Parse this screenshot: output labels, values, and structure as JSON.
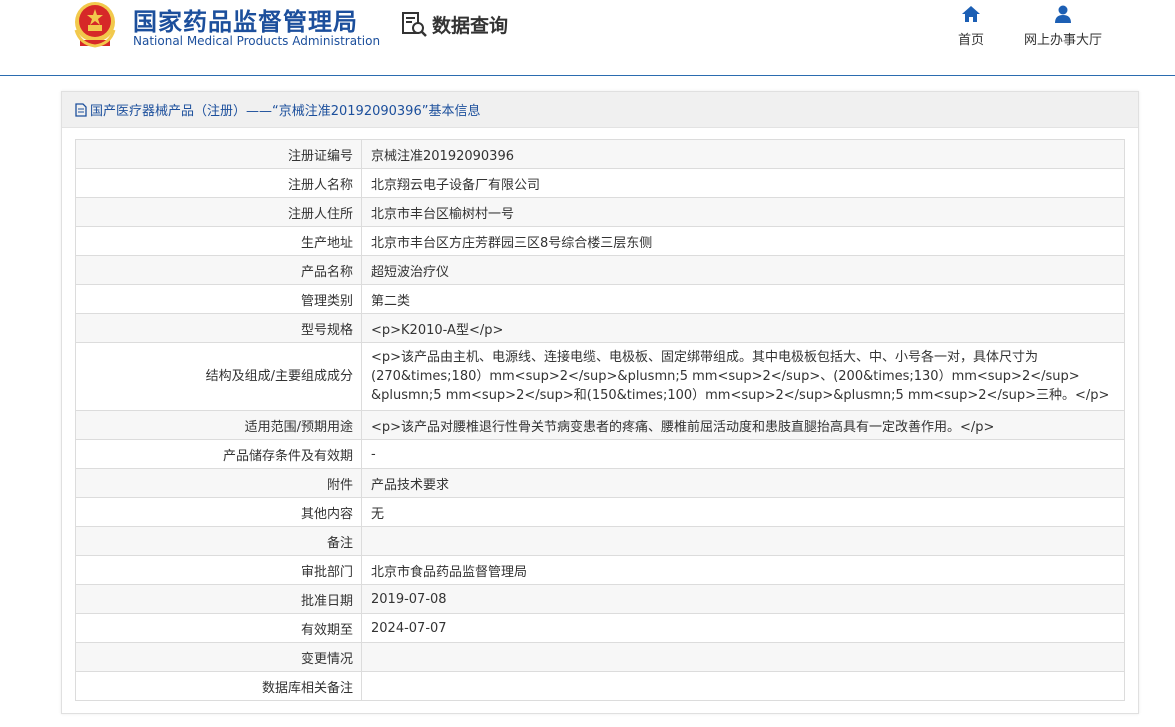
{
  "header": {
    "logo_cn": "国家药品监督管理局",
    "logo_en": "National Medical Products Administration",
    "data_query": "数据查询",
    "nav": [
      {
        "label": "首页",
        "icon": "home-icon"
      },
      {
        "label": "网上办事大厅",
        "icon": "user-icon"
      }
    ]
  },
  "panel": {
    "title": "国产医疗器械产品（注册）——“京械注准20192090396”基本信息"
  },
  "rows": [
    {
      "label": "注册证编号",
      "value": "京械注准20192090396"
    },
    {
      "label": "注册人名称",
      "value": "北京翔云电子设备厂有限公司"
    },
    {
      "label": "注册人住所",
      "value": "北京市丰台区榆树村一号"
    },
    {
      "label": "生产地址",
      "value": "北京市丰台区方庄芳群园三区8号综合楼三层东侧"
    },
    {
      "label": "产品名称",
      "value": "超短波治疗仪"
    },
    {
      "label": "管理类别",
      "value": "第二类"
    },
    {
      "label": "型号规格",
      "value": "<p>K2010-A型</p>"
    },
    {
      "label": "结构及组成/主要组成成分",
      "value": "<p>该产品由主机、电源线、连接电缆、电极板、固定绑带组成。其中电极板包括大、中、小号各一对，具体尺寸为(270&times;180）mm<sup>2</sup>&plusmn;5 mm<sup>2</sup>、(200&times;130）mm<sup>2</sup> &plusmn;5 mm<sup>2</sup>和(150&times;100）mm<sup>2</sup>&plusmn;5 mm<sup>2</sup>三种。</p>"
    },
    {
      "label": "适用范围/预期用途",
      "value": "<p>该产品对腰椎退行性骨关节病变患者的疼痛、腰椎前屈活动度和患肢直腿抬高具有一定改善作用。</p>"
    },
    {
      "label": "产品储存条件及有效期",
      "value": "-"
    },
    {
      "label": "附件",
      "value": "产品技术要求"
    },
    {
      "label": "其他内容",
      "value": "无"
    },
    {
      "label": "备注",
      "value": ""
    },
    {
      "label": "审批部门",
      "value": "北京市食品药品监督管理局"
    },
    {
      "label": "批准日期",
      "value": "2019-07-08"
    },
    {
      "label": "有效期至",
      "value": "2024-07-07"
    },
    {
      "label": "变更情况",
      "value": ""
    },
    {
      "label": "数据库相关备注",
      "value": ""
    }
  ]
}
